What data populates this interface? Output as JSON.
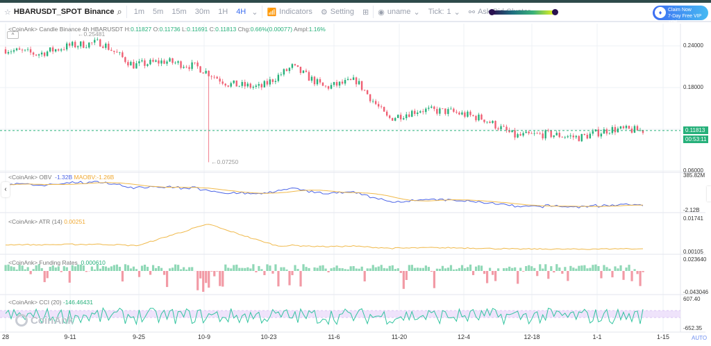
{
  "toolbar": {
    "symbol": "HBARUSDT_SPOT",
    "exchange": "Binance",
    "intervals": [
      "1m",
      "5m",
      "15m",
      "30m",
      "1H",
      "4H"
    ],
    "active_interval": "4H",
    "indicators": "Indicators",
    "setting": "Setting",
    "user": "uname",
    "tick_label": "Tick:",
    "tick_value": "1",
    "cluster": "Ask-Bid Cluster",
    "vip_line1": "Claim Now",
    "vip_line2": "7-Day Free VIP Trial"
  },
  "legend": {
    "candle": {
      "prefix": "<CoinAnk> Candle  Binance 4h HBARUSDT",
      "h_label": "H:",
      "h": "0.11827",
      "o_label": "O:",
      "o": "0.11736",
      "l_label": "L:",
      "l": "0.11691",
      "c_label": "C:",
      "c": "0.11813",
      "chg_label": "Chg:",
      "chg": "0.66%(0.00077)",
      "amp_label": "Ampl:",
      "amp": "1.16%"
    },
    "obv": {
      "name": "<CoinAnk> OBV",
      "value": "-1.32B",
      "ma": "MAOBV:-1.26B"
    },
    "atr": {
      "name": "<CoinAnk> ATR",
      "param": "(14)",
      "value": "0.00251"
    },
    "funding": {
      "name": "<CoinAnk> Funding Rates",
      "value": "0.000610"
    },
    "cci": {
      "name": "<CoinAnk> CCI",
      "param": "(20)",
      "value": "-146.46431"
    }
  },
  "price_axis": [
    "0.24000",
    "0.18000",
    "0.06000"
  ],
  "high_marker": "0.25481",
  "low_marker": "0.07250",
  "last_price": "0.11813",
  "countdown": "00:53:11",
  "obv_axis": [
    "385.82M",
    "-2.12B"
  ],
  "atr_axis": [
    "0.01741",
    "0.00105"
  ],
  "funding_axis": [
    "0.023640",
    "-0.043046"
  ],
  "cci_axis": [
    "607.40",
    "-652.35"
  ],
  "x_axis": [
    "28",
    "9-11",
    "9-25",
    "10-9",
    "10-23",
    "11-6",
    "11-20",
    "12-4",
    "12-18",
    "1-1",
    "1-15"
  ],
  "auto": "AUTO",
  "logo": "CoinAnk",
  "colors": {
    "up": "#26b07a",
    "down": "#ef5f73",
    "obv": "#4a63e6",
    "ma": "#f0b94a",
    "accent": "#3b6df0"
  },
  "chart_data": {
    "type": "candlestick",
    "x": [
      "8-28",
      "9-4",
      "9-11",
      "9-18",
      "9-25",
      "10-2",
      "10-9",
      "10-16",
      "10-23",
      "10-30",
      "11-6",
      "11-13",
      "11-20",
      "11-27",
      "12-4",
      "12-11",
      "12-18",
      "12-25",
      "1-1",
      "1-8",
      "1-11"
    ],
    "close": [
      0.235,
      0.228,
      0.24,
      0.245,
      0.212,
      0.218,
      0.21,
      0.185,
      0.18,
      0.21,
      0.18,
      0.19,
      0.135,
      0.148,
      0.145,
      0.135,
      0.11,
      0.113,
      0.108,
      0.12,
      0.11813
    ],
    "high_marker": 0.25481,
    "low_marker": 0.0725,
    "ylim": [
      0.06,
      0.26
    ],
    "grid": true
  }
}
